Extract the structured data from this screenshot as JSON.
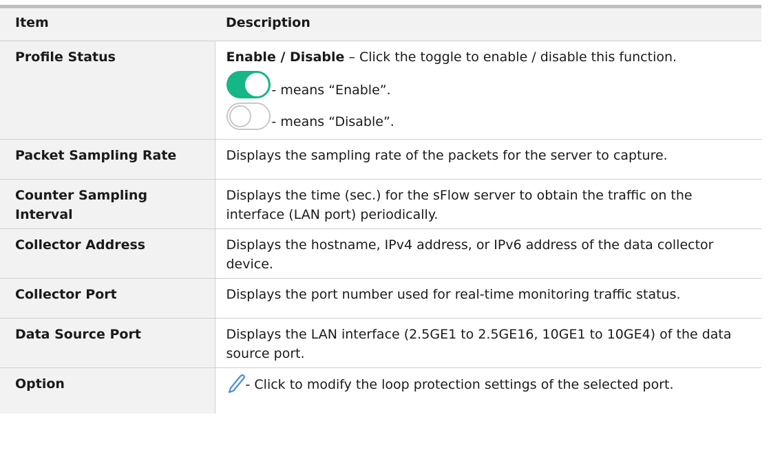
{
  "header": {
    "col_item": "Item",
    "col_desc": "Description"
  },
  "rows": [
    {
      "item": "Profile Status",
      "desc_bold": "Enable / Disable",
      "desc_rest": " – Click the toggle to enable / disable this function.",
      "toggle_on_text": "- means “Enable”.",
      "toggle_off_text": "- means “Disable”.",
      "toggle_on_color": "#17b687"
    },
    {
      "item": "Packet Sampling Rate",
      "desc": "Displays the sampling rate of the packets for the server to capture."
    },
    {
      "item": "Counter Sampling Interval",
      "desc": "Displays the time (sec.) for the sFlow server to obtain the traffic on the interface (LAN port) periodically."
    },
    {
      "item": "Collector Address",
      "desc": "Displays the hostname, IPv4 address, or IPv6 address of the data collector device."
    },
    {
      "item": "Collector Port",
      "desc": "Displays the port number used for real-time monitoring traffic status."
    },
    {
      "item": "Data Source Port",
      "desc": "Displays the LAN interface (2.5GE1 to 2.5GE16, 10GE1 to 10GE4) of the data source port."
    },
    {
      "item": "Option",
      "desc": "- Click to modify the loop protection settings of the selected port.",
      "icon": "pencil-icon"
    }
  ]
}
